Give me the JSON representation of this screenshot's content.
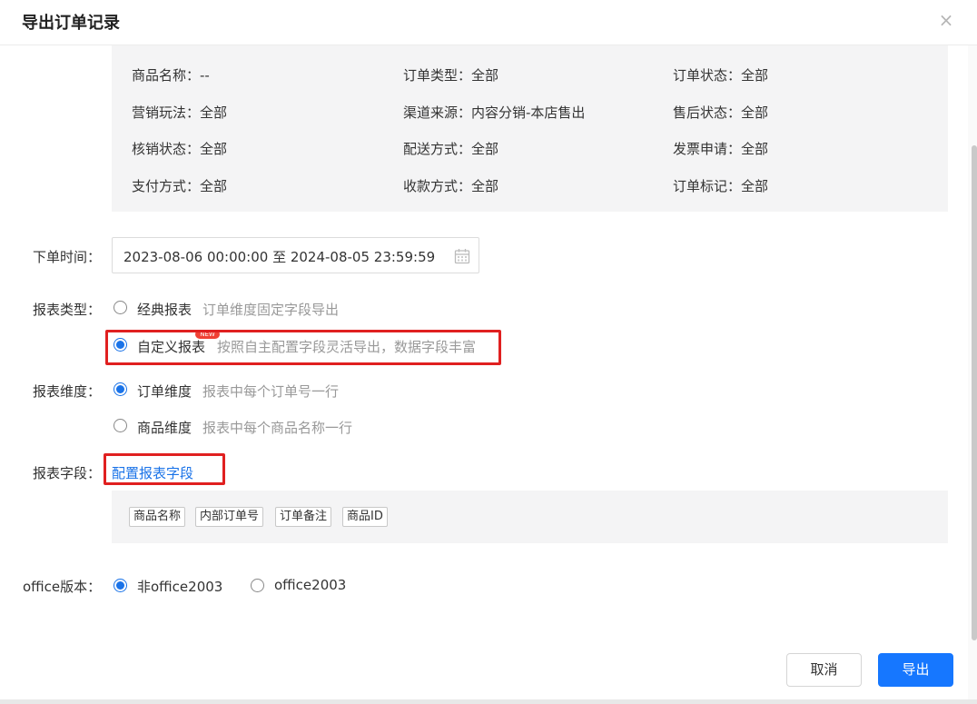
{
  "dialog": {
    "title": "导出订单记录",
    "close_glyph": "×"
  },
  "filters": [
    {
      "label": "商品名称：",
      "value": "--"
    },
    {
      "label": "订单类型：",
      "value": "全部"
    },
    {
      "label": "订单状态：",
      "value": "全部"
    },
    {
      "label": "营销玩法：",
      "value": "全部"
    },
    {
      "label": "渠道来源：",
      "value": "内容分销-本店售出"
    },
    {
      "label": "售后状态：",
      "value": "全部"
    },
    {
      "label": "核销状态：",
      "value": "全部"
    },
    {
      "label": "配送方式：",
      "value": "全部"
    },
    {
      "label": "发票申请：",
      "value": "全部"
    },
    {
      "label": "支付方式：",
      "value": "全部"
    },
    {
      "label": "收款方式：",
      "value": "全部"
    },
    {
      "label": "订单标记：",
      "value": "全部"
    }
  ],
  "order_time": {
    "label": "下单时间：",
    "value": "2023-08-06 00:00:00 至 2024-08-05 23:59:59"
  },
  "report_type": {
    "label": "报表类型：",
    "options": [
      {
        "label": "经典报表",
        "hint": "订单维度固定字段导出",
        "selected": false
      },
      {
        "label": "自定义报表",
        "hint": "按照自主配置字段灵活导出，数据字段丰富",
        "selected": true,
        "badge": "NEW"
      }
    ]
  },
  "report_dimension": {
    "label": "报表维度：",
    "options": [
      {
        "label": "订单维度",
        "hint": "报表中每个订单号一行",
        "selected": true
      },
      {
        "label": "商品维度",
        "hint": "报表中每个商品名称一行",
        "selected": false
      }
    ]
  },
  "report_fields": {
    "label": "报表字段：",
    "link": "配置报表字段",
    "tags": [
      "商品名称",
      "内部订单号",
      "订单备注",
      "商品ID"
    ]
  },
  "office_version": {
    "label": "office版本：",
    "options": [
      {
        "label": "非office2003",
        "selected": true
      },
      {
        "label": "office2003",
        "selected": false
      }
    ]
  },
  "buttons": {
    "cancel": "取消",
    "export": "导出"
  },
  "colors": {
    "accent": "#1677ff",
    "highlight_box": "#e02020",
    "panel_bg": "#f4f4f5"
  }
}
